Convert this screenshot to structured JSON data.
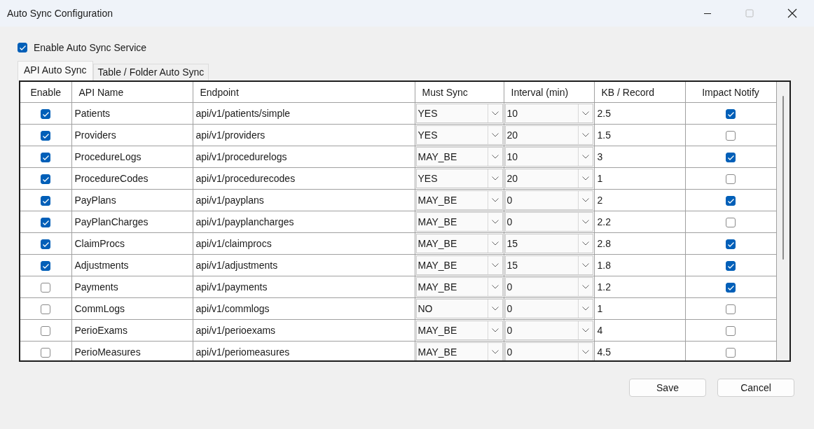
{
  "window": {
    "title": "Auto Sync Configuration"
  },
  "enable_service": {
    "label": "Enable Auto Sync Service",
    "checked": true
  },
  "tabs": [
    {
      "label": "API Auto Sync",
      "selected": true
    },
    {
      "label": "Table / Folder Auto Sync",
      "selected": false
    }
  ],
  "table": {
    "columns": [
      "Enable",
      "API Name",
      "Endpoint",
      "Must Sync",
      "Interval (min)",
      "KB / Record",
      "Impact Notify"
    ],
    "rows": [
      {
        "enabled": true,
        "name": "Patients",
        "endpoint": "api/v1/patients/simple",
        "must_sync": "YES",
        "interval": "10",
        "kb": "2.5",
        "impact_notify": true
      },
      {
        "enabled": true,
        "name": "Providers",
        "endpoint": "api/v1/providers",
        "must_sync": "YES",
        "interval": "20",
        "kb": "1.5",
        "impact_notify": false
      },
      {
        "enabled": true,
        "name": "ProcedureLogs",
        "endpoint": "api/v1/procedurelogs",
        "must_sync": "MAY_BE",
        "interval": "10",
        "kb": "3",
        "impact_notify": true
      },
      {
        "enabled": true,
        "name": "ProcedureCodes",
        "endpoint": "api/v1/procedurecodes",
        "must_sync": "YES",
        "interval": "20",
        "kb": "1",
        "impact_notify": false
      },
      {
        "enabled": true,
        "name": "PayPlans",
        "endpoint": "api/v1/payplans",
        "must_sync": "MAY_BE",
        "interval": "0",
        "kb": "2",
        "impact_notify": true
      },
      {
        "enabled": true,
        "name": "PayPlanCharges",
        "endpoint": "api/v1/payplancharges",
        "must_sync": "MAY_BE",
        "interval": "0",
        "kb": "2.2",
        "impact_notify": false
      },
      {
        "enabled": true,
        "name": "ClaimProcs",
        "endpoint": "api/v1/claimprocs",
        "must_sync": "MAY_BE",
        "interval": "15",
        "kb": "2.8",
        "impact_notify": true
      },
      {
        "enabled": true,
        "name": "Adjustments",
        "endpoint": "api/v1/adjustments",
        "must_sync": "MAY_BE",
        "interval": "15",
        "kb": "1.8",
        "impact_notify": true
      },
      {
        "enabled": false,
        "name": "Payments",
        "endpoint": "api/v1/payments",
        "must_sync": "MAY_BE",
        "interval": "0",
        "kb": "1.2",
        "impact_notify": true
      },
      {
        "enabled": false,
        "name": "CommLogs",
        "endpoint": "api/v1/commlogs",
        "must_sync": "NO",
        "interval": "0",
        "kb": "1",
        "impact_notify": false
      },
      {
        "enabled": false,
        "name": "PerioExams",
        "endpoint": "api/v1/perioexams",
        "must_sync": "MAY_BE",
        "interval": "0",
        "kb": "4",
        "impact_notify": false
      },
      {
        "enabled": false,
        "name": "PerioMeasures",
        "endpoint": "api/v1/periomeasures",
        "must_sync": "MAY_BE",
        "interval": "0",
        "kb": "4.5",
        "impact_notify": false
      }
    ]
  },
  "buttons": [
    "Save",
    "Cancel"
  ]
}
